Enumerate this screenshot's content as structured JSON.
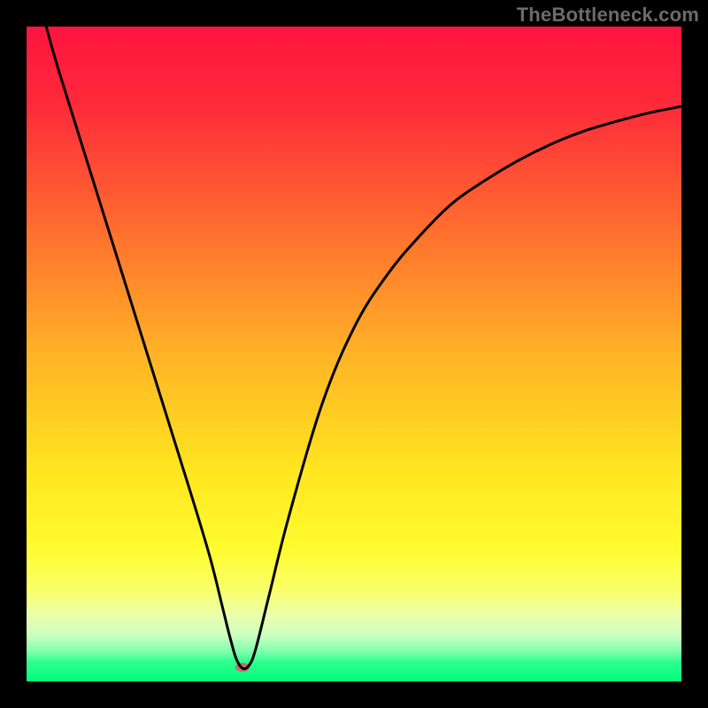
{
  "watermark": "TheBottleneck.com",
  "colors": {
    "frame": "#000000",
    "curve": "#000000",
    "marker": "#c76e6a",
    "gradient_stops": [
      {
        "pct": 0,
        "color": "#ff1440"
      },
      {
        "pct": 12,
        "color": "#ff2a3a"
      },
      {
        "pct": 30,
        "color": "#ff6a2f"
      },
      {
        "pct": 50,
        "color": "#ffb326"
      },
      {
        "pct": 68,
        "color": "#ffe61f"
      },
      {
        "pct": 80,
        "color": "#fffc30"
      },
      {
        "pct": 86,
        "color": "#f9ff6a"
      },
      {
        "pct": 90,
        "color": "#eaffad"
      },
      {
        "pct": 93,
        "color": "#c9ffc0"
      },
      {
        "pct": 95.5,
        "color": "#7dffad"
      },
      {
        "pct": 97,
        "color": "#2dff8f"
      },
      {
        "pct": 100,
        "color": "#00ff78"
      }
    ]
  },
  "chart_data": {
    "type": "line",
    "title": "",
    "xlabel": "",
    "ylabel": "",
    "xlim": [
      0,
      100
    ],
    "ylim": [
      0,
      100
    ],
    "series": [
      {
        "name": "bottleneck-curve",
        "x": [
          3,
          5,
          10,
          15,
          20,
          25,
          28,
          30,
          31,
          32,
          33,
          34,
          35,
          37,
          40,
          45,
          50,
          55,
          60,
          65,
          70,
          75,
          80,
          85,
          90,
          95,
          100
        ],
        "y": [
          100,
          93,
          77,
          61,
          45,
          29,
          19,
          11,
          7,
          3.5,
          2,
          2.5,
          5,
          13,
          25,
          42,
          54,
          62,
          68,
          73,
          76.5,
          79.5,
          82,
          84,
          85.5,
          86.8,
          87.8
        ]
      }
    ],
    "optimum": {
      "x": 33,
      "y": 2.2
    },
    "marker_size_px": {
      "w": 16,
      "h": 10
    }
  }
}
